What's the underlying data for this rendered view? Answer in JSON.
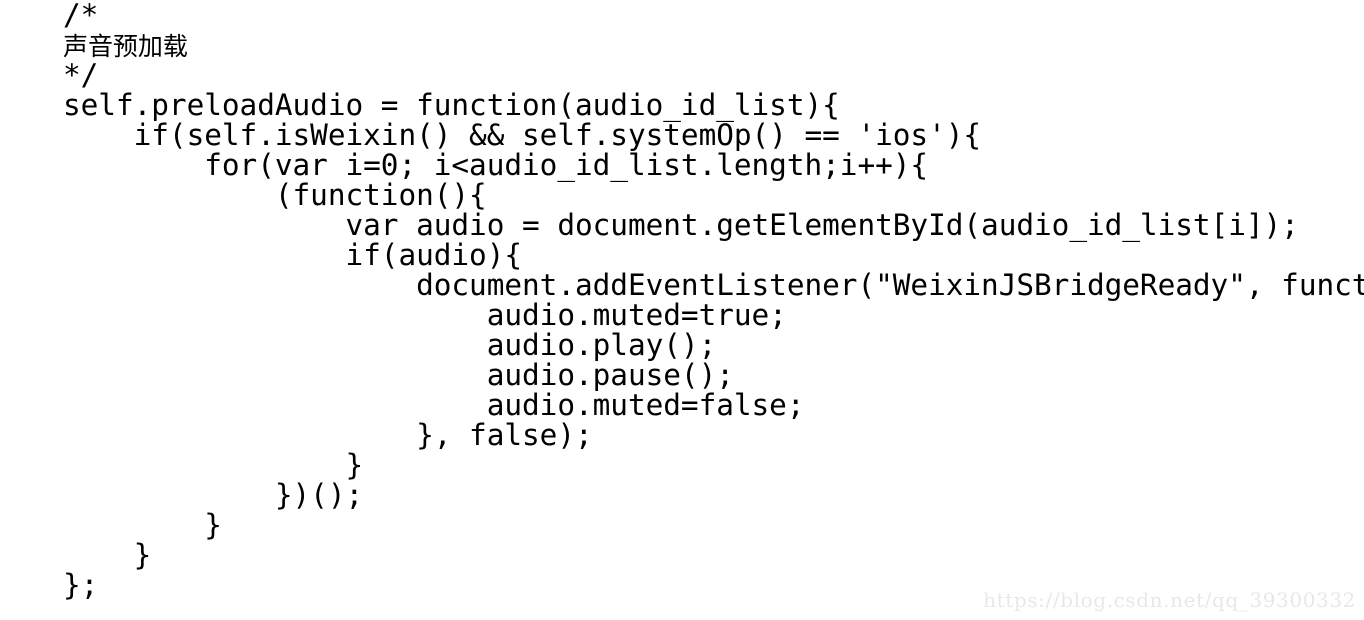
{
  "document": {
    "type": "code-snippet",
    "language": "javascript",
    "background_color": "#ffffff",
    "text_color": "#000000",
    "code_lines": [
      "/*",
      "声音预加载",
      "*/",
      "self.preloadAudio = function(audio_id_list){",
      "    if(self.isWeixin() && self.systemOp() == 'ios'){",
      "        for(var i=0; i<audio_id_list.length;i++){",
      "            (function(){",
      "                var audio = document.getElementById(audio_id_list[i]);",
      "                if(audio){",
      "                    document.addEventListener(\"WeixinJSBridgeReady\", function () {",
      "                        audio.muted=true;",
      "                        audio.play();",
      "                        audio.pause();",
      "                        audio.muted=false;",
      "                    }, false);",
      "                }",
      "            })();",
      "        }",
      "    }",
      "};"
    ]
  },
  "watermark": {
    "text": "https://blog.csdn.net/qq_39300332",
    "color": "#e8e8e8"
  }
}
